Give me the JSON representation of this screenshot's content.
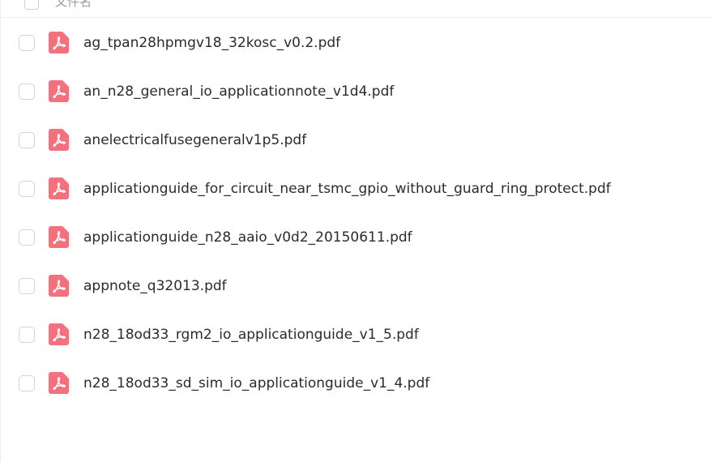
{
  "header": {
    "name_column_label": "文件名"
  },
  "files": [
    {
      "name": "ag_tpan28hpmgv18_32kosc_v0.2.pdf",
      "icon": "pdf-icon"
    },
    {
      "name": "an_n28_general_io_applicationnote_v1d4.pdf",
      "icon": "pdf-icon"
    },
    {
      "name": "anelectricalfusegeneralv1p5.pdf",
      "icon": "pdf-icon"
    },
    {
      "name": "applicationguide_for_circuit_near_tsmc_gpio_without_guard_ring_protect.pdf",
      "icon": "pdf-icon"
    },
    {
      "name": "applicationguide_n28_aaio_v0d2_20150611.pdf",
      "icon": "pdf-icon"
    },
    {
      "name": "appnote_q32013.pdf",
      "icon": "pdf-icon"
    },
    {
      "name": "n28_18od33_rgm2_io_applicationguide_v1_5.pdf",
      "icon": "pdf-icon"
    },
    {
      "name": "n28_18od33_sd_sim_io_applicationguide_v1_4.pdf",
      "icon": "pdf-icon"
    }
  ],
  "colors": {
    "pdf_icon": "#f2717c",
    "text": "#2b2b2b",
    "checkbox_border": "#d4d4d4"
  }
}
